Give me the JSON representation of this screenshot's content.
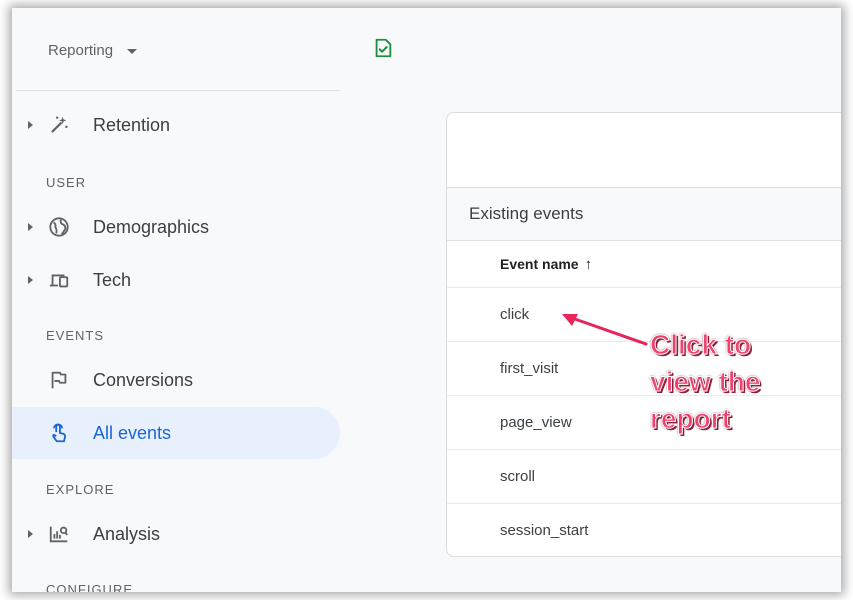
{
  "sidebar": {
    "reporting_label": "Reporting",
    "items": [
      {
        "label": "Retention",
        "icon": "magic-wand-icon"
      },
      {
        "label": "Demographics",
        "icon": "globe-icon"
      },
      {
        "label": "Tech",
        "icon": "devices-icon"
      },
      {
        "label": "Conversions",
        "icon": "flag-icon"
      },
      {
        "label": "All events",
        "icon": "touch-icon"
      },
      {
        "label": "Analysis",
        "icon": "analysis-icon"
      }
    ],
    "sections": {
      "user": "USER",
      "events": "EVENTS",
      "explore": "EXPLORE",
      "configure": "CONFIGURE"
    }
  },
  "card": {
    "section_title": "Existing events",
    "column_header": "Event name",
    "sort_arrow": "↑",
    "rows": [
      "click",
      "first_visit",
      "page_view",
      "scroll",
      "session_start"
    ]
  },
  "annotation": {
    "line1": "Click to",
    "line2": "view the",
    "line3": "report",
    "color": "#f0426e"
  },
  "colors": {
    "active_bg": "#e8f0fe",
    "active_text": "#1967d2",
    "check_icon": "#1e8e3e"
  }
}
